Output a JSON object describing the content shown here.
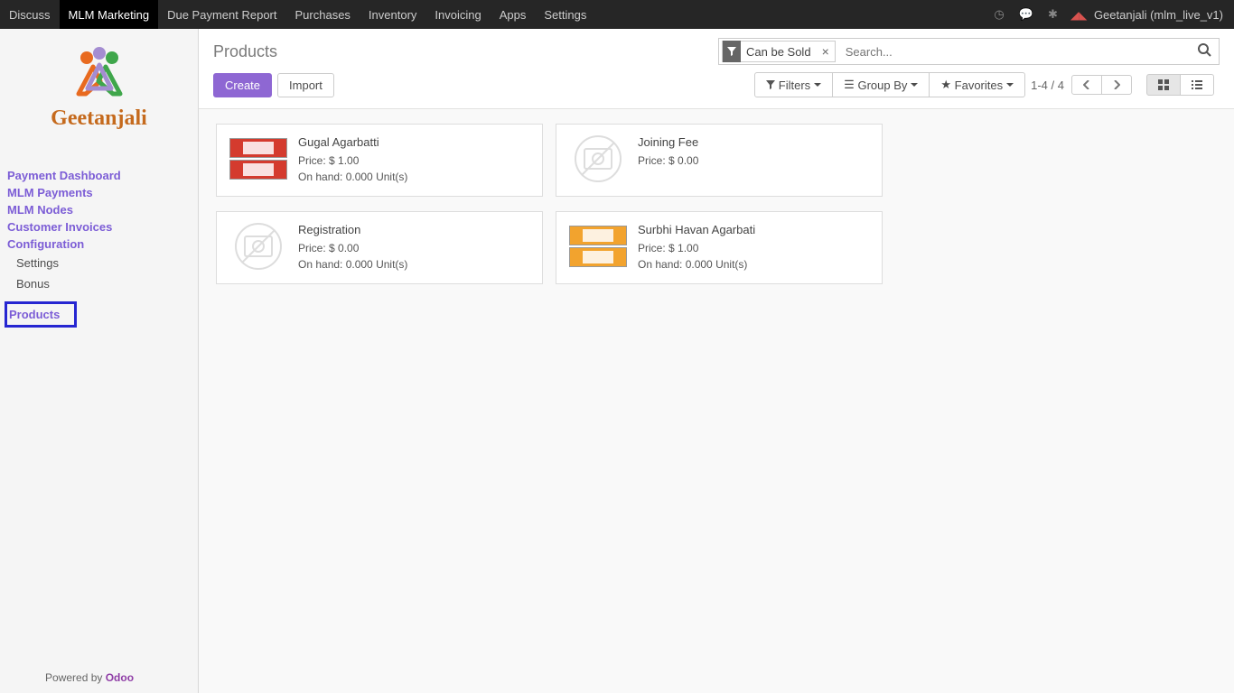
{
  "topnav": {
    "items": [
      "Discuss",
      "MLM Marketing",
      "Due Payment Report",
      "Purchases",
      "Inventory",
      "Invoicing",
      "Apps",
      "Settings"
    ],
    "active_index": 1,
    "user": "Geetanjali (mlm_live_v1)"
  },
  "sidebar": {
    "brand": "Geetanjali",
    "menu": [
      {
        "label": "Payment Dashboard",
        "type": "main"
      },
      {
        "label": "MLM Payments",
        "type": "main"
      },
      {
        "label": "MLM Nodes",
        "type": "main"
      },
      {
        "label": "Customer Invoices",
        "type": "main"
      },
      {
        "label": "Configuration",
        "type": "main"
      },
      {
        "label": "Settings",
        "type": "sub"
      },
      {
        "label": "Bonus",
        "type": "sub"
      },
      {
        "label": "Products",
        "type": "highlighted"
      }
    ],
    "powered_by": "Powered by ",
    "powered_by_brand": "Odoo"
  },
  "control_panel": {
    "breadcrumb": "Products",
    "search": {
      "facet_label": "Can be Sold",
      "placeholder": "Search..."
    },
    "buttons": {
      "create": "Create",
      "import": "Import"
    },
    "filters_label": "Filters",
    "groupby_label": "Group By",
    "favorites_label": "Favorites",
    "pager": {
      "range": "1-4",
      "sep": " / ",
      "total": "4"
    }
  },
  "products": [
    {
      "name": "Gugal Agarbatti",
      "price": "Price: $ 1.00",
      "onhand": "On hand: 0.000 Unit(s)",
      "img": "red"
    },
    {
      "name": "Joining Fee",
      "price": "Price: $ 0.00",
      "onhand": "",
      "img": "none"
    },
    {
      "name": "Registration",
      "price": "Price: $ 0.00",
      "onhand": "On hand: 0.000 Unit(s)",
      "img": "none"
    },
    {
      "name": "Surbhi Havan Agarbati",
      "price": "Price: $ 1.00",
      "onhand": "On hand: 0.000 Unit(s)",
      "img": "orange"
    }
  ]
}
